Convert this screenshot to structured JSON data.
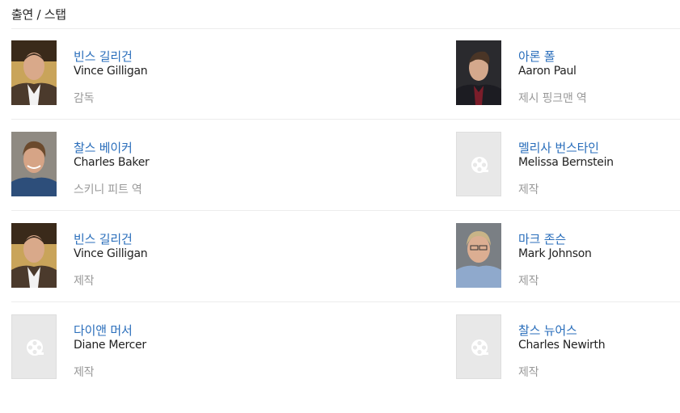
{
  "section": {
    "title": "출연 / 스탭"
  },
  "people": [
    {
      "name_ko": "빈스 길리건",
      "name_en": "Vince Gilligan",
      "role": "감독",
      "photo": "vince-gilligan-photo"
    },
    {
      "name_ko": "아론 폴",
      "name_en": "Aaron Paul",
      "role": "제시 핑크맨 역",
      "photo": "aaron-paul-photo"
    },
    {
      "name_ko": "찰스 베이커",
      "name_en": "Charles Baker",
      "role": "스키니 피트 역",
      "photo": "charles-baker-photo"
    },
    {
      "name_ko": "멜리사 번스타인",
      "name_en": "Melissa Bernstein",
      "role": "제작",
      "photo": "film-reel-placeholder-icon"
    },
    {
      "name_ko": "빈스 길리건",
      "name_en": "Vince Gilligan",
      "role": "제작",
      "photo": "vince-gilligan-photo"
    },
    {
      "name_ko": "마크 존슨",
      "name_en": "Mark Johnson",
      "role": "제작",
      "photo": "mark-johnson-photo"
    },
    {
      "name_ko": "다이앤 머서",
      "name_en": "Diane Mercer",
      "role": "제작",
      "photo": "film-reel-placeholder-icon"
    },
    {
      "name_ko": "찰스 뉴어스",
      "name_en": "Charles Newirth",
      "role": "제작",
      "photo": "film-reel-placeholder-icon"
    }
  ],
  "colors": {
    "link": "#2a6ebb",
    "text": "#222222",
    "muted": "#999999",
    "divider": "#ececec",
    "placeholder": "#e8e8e8"
  }
}
